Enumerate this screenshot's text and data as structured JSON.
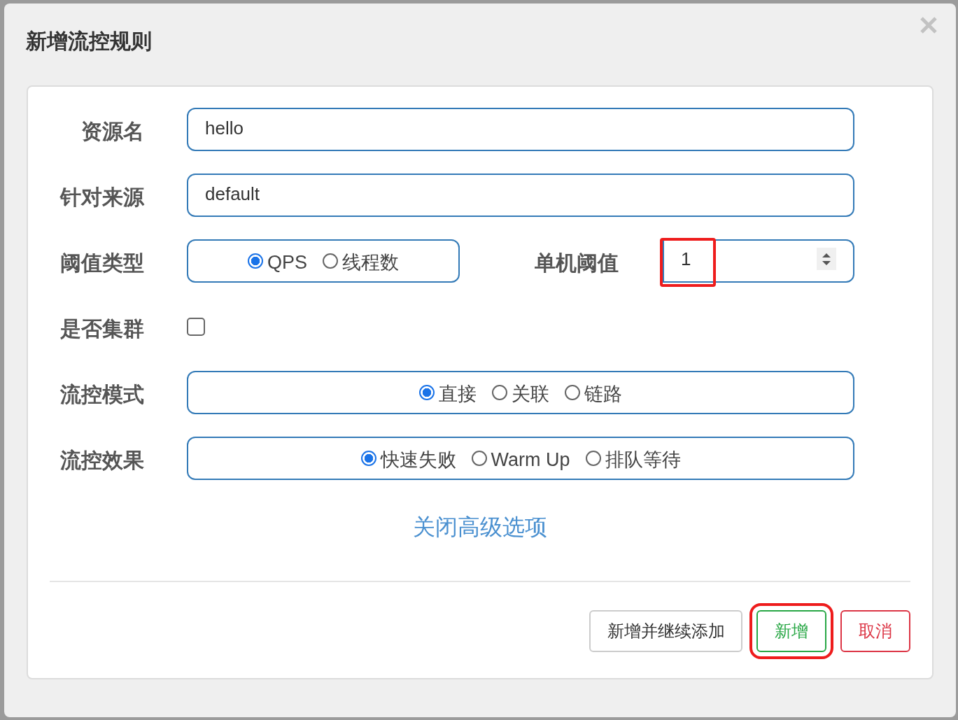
{
  "dialog": {
    "title": "新增流控规则"
  },
  "fields": [
    {
      "kind": "text",
      "label": "资源名",
      "value": "hello"
    },
    {
      "kind": "text",
      "label": "针对来源",
      "value": "default"
    },
    {
      "kind": "threshold",
      "label": "阈值类型",
      "options": [
        {
          "label": "QPS",
          "selected": true
        },
        {
          "label": "线程数",
          "selected": false
        }
      ],
      "number_label": "单机阈值",
      "number_value": "1",
      "highlighted": true
    },
    {
      "kind": "checkbox",
      "label": "是否集群",
      "checked": false
    },
    {
      "kind": "radio",
      "label": "流控模式",
      "options": [
        {
          "label": "直接",
          "selected": true
        },
        {
          "label": "关联",
          "selected": false
        },
        {
          "label": "链路",
          "selected": false
        }
      ]
    },
    {
      "kind": "radio",
      "label": "流控效果",
      "options": [
        {
          "label": "快速失败",
          "selected": true
        },
        {
          "label": "Warm Up",
          "selected": false
        },
        {
          "label": "排队等待",
          "selected": false
        }
      ]
    }
  ],
  "advanced_link": "关闭高级选项",
  "buttons": [
    {
      "label": "新增并继续添加",
      "kind": "default",
      "highlighted": false
    },
    {
      "label": "新增",
      "kind": "success",
      "highlighted": true
    },
    {
      "label": "取消",
      "kind": "danger",
      "highlighted": false
    }
  ]
}
